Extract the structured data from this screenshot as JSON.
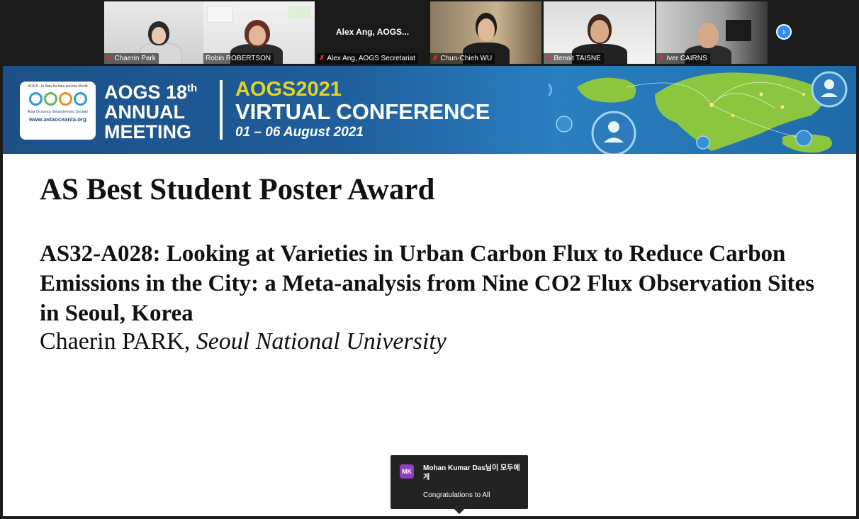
{
  "participants": [
    {
      "name": "Chaerin Park",
      "muted": true,
      "video": true
    },
    {
      "name": "Robin ROBERTSON",
      "muted": false,
      "video": true,
      "active_speaker": true
    },
    {
      "name": "Alex Ang, AOGS Secretariat",
      "display_title": "Alex Ang, AOGS...",
      "muted": true,
      "video": false
    },
    {
      "name": "Chun-Chieh WU",
      "muted": true,
      "video": true
    },
    {
      "name": "Benoit TAISNE",
      "muted": true,
      "video": true
    },
    {
      "name": "Iver CAIRNS",
      "muted": true,
      "video": true
    }
  ],
  "icons": {
    "muted": "mic-muted-icon",
    "next": "chevron-right-icon"
  },
  "banner": {
    "logo_tagline": "AOGS...In Asia for Asia and the World",
    "logo_society": "Asia Oceania Geosciences Society",
    "logo_url": "www.asiaoceania.org",
    "meeting_line1": "AOGS 18",
    "meeting_sup": "th",
    "meeting_line2": "ANNUAL",
    "meeting_line3": "MEETING",
    "conf_line1": "AOGS2021",
    "conf_line2": "VIRTUAL CONFERENCE",
    "conf_line3": "01 – 06 August 2021"
  },
  "slide": {
    "title": "AS Best Student Poster Award",
    "abstract": "AS32-A028: Looking at Varieties in Urban Carbon Flux to Reduce Carbon Emissions in the City: a Meta-analysis from Nine CO2 Flux Observation Sites in Seoul, Korea",
    "author": "Chaerin PARK,",
    "affiliation": "Seoul National University"
  },
  "chat": {
    "avatar_initials": "MK",
    "sender": "Mohan Kumar Das님이 모두에게",
    "message": "Congratulations to All"
  },
  "colors": {
    "accent": "#2d8cff",
    "active_speaker": "#7ecb3e",
    "banner_blue": "#1f5e9c",
    "banner_yellow": "#e0d32b",
    "avatar": "#8e3fbf"
  }
}
